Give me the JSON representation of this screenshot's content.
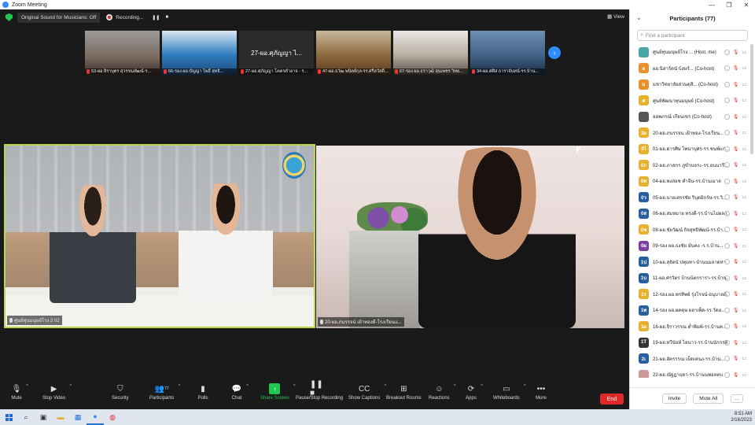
{
  "window": {
    "title": "Zoom Meeting",
    "controls": [
      "—",
      "❐",
      "✕"
    ]
  },
  "topbar": {
    "original_sound": "Original Sound for Musicians: Off",
    "recording": "Recording...",
    "pause_icon": "❚❚",
    "stop_icon": "■",
    "view": "View"
  },
  "thumbnails": [
    {
      "label": "53-ผอ.จิราบุตร สุวรรณพัฒน์-ร..."
    },
    {
      "label": "66-รอง ผอ.บัญญา โพธิ์ สุทธิ..."
    },
    {
      "label": "27-ผอ.ศุภัญญา โคตรคำอาจ - ร...",
      "center_text": "27-ผอ.ศุภัญญา ไ..."
    },
    {
      "label": "47-ผอ.ธวัฒ พนิตย์กุล-รร.ศรีสวัสดิ์..."
    },
    {
      "label": "67-รอง ผอ.ธราวุฒิ อุ่นเพชร วิทย..."
    },
    {
      "label": "34-ผอ.ศศิส ธาราจันทน์-รร.บ้าน..."
    }
  ],
  "videos": {
    "left_name": "ศูนย์ทุนมนุษย์โรง 2 02",
    "right_name": "20-ผอ.ภนรรจน์ เฝ้าทองดี-โรงเรียนแ..."
  },
  "toolbar": {
    "mute": "Mute",
    "stop_video": "Stop Video",
    "security": "Security",
    "participants": "Participants",
    "participants_count": "77",
    "polls": "Polls",
    "chat": "Chat",
    "share_screen": "Share Screen",
    "pause_recording": "Pause/Stop Recording",
    "show_captions": "Show Captions",
    "breakout_rooms": "Breakout Rooms",
    "reactions": "Reactions",
    "apps": "Apps",
    "whiteboards": "Whiteboards",
    "more": "More",
    "end": "End"
  },
  "panel": {
    "title": "Participants (77)",
    "search_placeholder": "Find a participant",
    "invite": "Invite",
    "mute_all": "Mute All",
    "more": "..."
  },
  "participants": [
    {
      "avatar": "",
      "color": "#4aa6a6",
      "name": "ศูนย์ทุนมนุษย์โรง ... (Host, me)"
    },
    {
      "avatar": "ผ",
      "color": "#e8912d",
      "name": "ผอ.นิสาร์ดนั บ้งษร์... (Co-host)"
    },
    {
      "avatar": "ม",
      "color": "#e8912d",
      "name": "มหาวิทยาลัยสวนดุสิ... (Co-host)"
    },
    {
      "avatar": "ศ",
      "color": "#e8b12d",
      "name": "ศูนย์พัฒนาทุนมนุษย์ (Co-host)"
    },
    {
      "avatar": "",
      "color": "#555555",
      "name": "ออพภรณ์ เกียนเขร (Co-host)"
    },
    {
      "avatar": "2ผ",
      "color": "#e8b12d",
      "name": "20-ผอ.ภนรรจน เฝ้าทอง-โรงเรียน..."
    },
    {
      "avatar": "0ไ",
      "color": "#e8b12d",
      "name": "01-ผอ.ดารศิษ ไพนาบุศร-รร.ชนพ์แก่..."
    },
    {
      "avatar": "0ภ",
      "color": "#e8b12d",
      "name": "02-ผอ.ภาสกร ภู่ขำนจระ-รร.อนนารี..."
    },
    {
      "avatar": "0พ",
      "color": "#e8b12d",
      "name": "04-ผอ.พงสอช คำจีน-รร.บ้านเมาล"
    },
    {
      "avatar": "0ว",
      "color": "#2a5f9e",
      "name": "05-ผอ.นายเสรรชัย ริบุตมิกร์ษ-รร.วิ..."
    },
    {
      "avatar": "0ส",
      "color": "#2a5f9e",
      "name": "06-ผอ.สมหมาย ทรงดี-รร.บ้านไม่ผลา..."
    },
    {
      "avatar": "0ช",
      "color": "#e8b12d",
      "name": "08-ผอ.ขัยวัฒน์ กิจสุทธิพัฒน์-รร.บ้า..."
    },
    {
      "avatar": "0ผ",
      "color": "#7a3fa0",
      "name": "09-รอง ผอ.ธงชัย มั่นคง -ร.ร.บ้าน..."
    },
    {
      "avatar": "1ป",
      "color": "#2a5f9e",
      "name": "10-ผอ.สุจัดนั ปทุมทา-บ้านนมลาดหา"
    },
    {
      "avatar": "1บ",
      "color": "#2a5f9e",
      "name": "11-ผอ.ศรวัตร บ้านน้ตกรารา-รร.บ้าน..."
    },
    {
      "avatar": "1ร",
      "color": "#e8b12d",
      "name": "12-รอง.ผอ.พรทิพย์ รุ่งโรจน์-อนุบาลดี..."
    },
    {
      "avatar": "1พ",
      "color": "#2a5f9e",
      "name": "14-รอง ผอ.ผดดุษ ผลาเพ็ด-รร.วัดฮ..."
    },
    {
      "avatar": "1ผ",
      "color": "#e8b12d",
      "name": "16-ผอ.จิราวรรณ ต่ำพิมพ์-รร.บ้านค..."
    },
    {
      "avatar": "1T",
      "color": "#333333",
      "name": "19-ผอ.ทวีนัยท์ ไยนาว-รร.บ้านนักกรดี"
    },
    {
      "avatar": "2เ",
      "color": "#2a5f9e",
      "name": "21-ผอ.อัครรรณ เม็ดเคนง-รร.บ้าน..."
    },
    {
      "avatar": "",
      "color": "#c99",
      "name": "22-ผอ.ณัฐฎาฤดา-รร.บ้านนพอลตบ"
    }
  ],
  "taskbar": {
    "time": "8:51 AM",
    "date": "2/16/2023"
  },
  "colors": {
    "accent": "#2d8cff",
    "active_speaker": "#b7d84a",
    "end": "#e02828",
    "share": "#23c551"
  }
}
